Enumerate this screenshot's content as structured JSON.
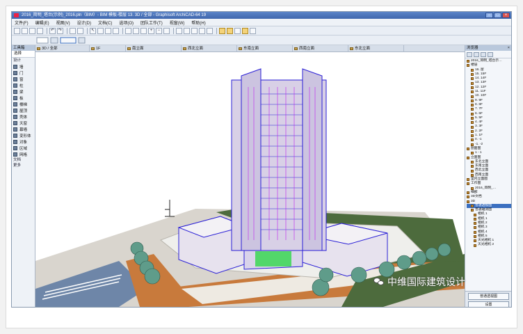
{
  "window": {
    "title": "2016_简明_塔台(示例)_2016.pln（BIM）- BIM 模板-楼层 13. 3D / 全部 - Graphisoft ArchiCAD-64 19",
    "controls": [
      "–",
      "□",
      "×"
    ]
  },
  "menubar": [
    "文件(F)",
    "编辑(E)",
    "视图(V)",
    "设计(D)",
    "文档(C)",
    "选项(O)",
    "团队工作(T)",
    "视窗(W)",
    "帮助(H)"
  ],
  "toolbox": {
    "header": "工具箱",
    "select_label": "选择",
    "section_label": "设计",
    "tools": [
      "墙",
      "门",
      "窗",
      "柱",
      "梁",
      "板",
      "楼梯",
      "屋顶",
      "壳体",
      "天窗",
      "幕墙",
      "变形体",
      "对象",
      "区域",
      "网格"
    ],
    "more": [
      "文档",
      "更多"
    ]
  },
  "tabs": [
    {
      "label": "3D / 全部",
      "icon": "view-icon"
    },
    {
      "label": "1F",
      "icon": "floorplan-icon"
    },
    {
      "label": "南立面",
      "icon": "elevation-icon"
    },
    {
      "label": "西北立面",
      "icon": "elevation-icon"
    },
    {
      "label": "东南立面",
      "icon": "elevation-icon"
    },
    {
      "label": "西南立面",
      "icon": "elevation-icon"
    },
    {
      "label": "东北立面",
      "icon": "elevation-icon"
    }
  ],
  "navigator": {
    "header": "浏览器",
    "tree": [
      "2016_简明_塔台示…",
      "楼层",
      "16. 屋",
      "15. 15F",
      "14. 14F",
      "13. 13F",
      "12. 12F",
      "11. 11F",
      "10. 10F",
      "9. 9F",
      "8. 8F",
      "7. 7F",
      "6. 6F",
      "5. 5F",
      "4. 4F",
      "3. 3F",
      "2. 2F",
      "1. 1F",
      "0. -1",
      "-1. -2",
      "剖面图",
      "1 - 1",
      "立面图",
      "东北立面",
      "东南立面",
      "西北立面",
      "西南立面",
      "室内立面图",
      "工作图",
      "2016_简明_…",
      "细部",
      "3D文档",
      "3D",
      "普通透视图",
      "普通轴测图",
      "相机 1",
      "相机 1",
      "相机 2",
      "相机 3",
      "相机 4",
      "相机 5",
      "天光相机 1",
      "天光相机 2"
    ],
    "selected": "普通透视图",
    "footer_buttons": [
      "普通透视图",
      "设置"
    ]
  },
  "watermark": "中维国际建筑设计",
  "colors": {
    "building_outline": "#2a1fd6",
    "building_accent": "#c21ef0",
    "ground_road": "#c87a3c",
    "lawn": "#4d6b3d",
    "tree": "#5f9c8a",
    "glass": "#2fd84a"
  }
}
